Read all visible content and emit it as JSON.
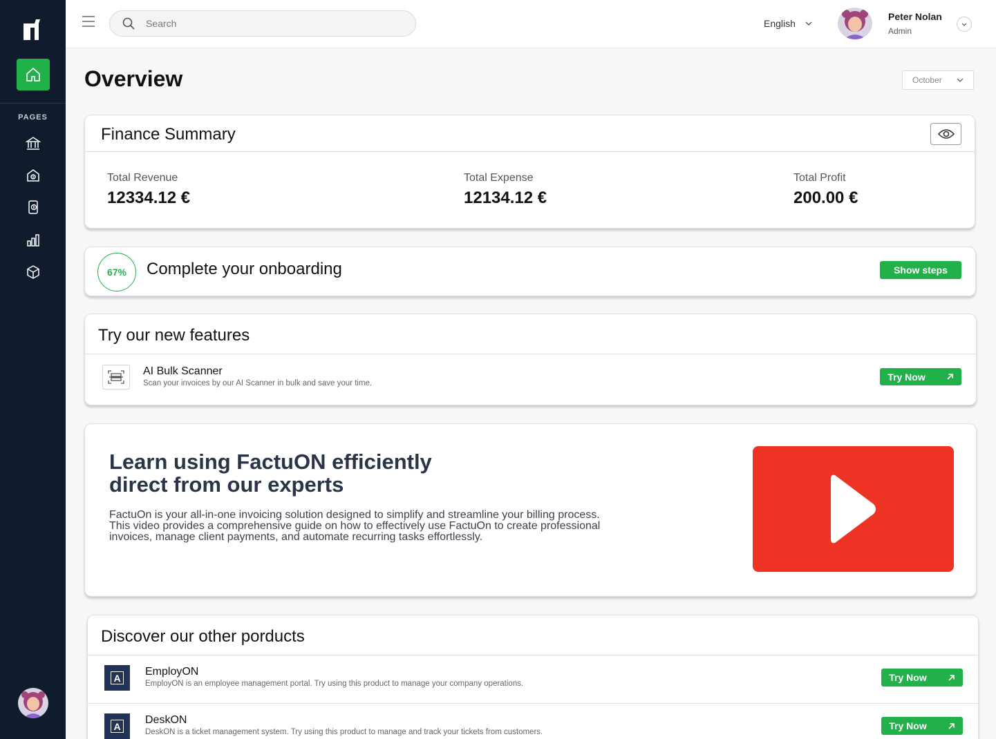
{
  "header": {
    "search_placeholder": "Search",
    "language": "English",
    "user_name": "Peter Nolan",
    "user_role": "Admin"
  },
  "sidebar": {
    "section_label": "PAGES",
    "icons": [
      "home-icon",
      "bank-icon",
      "safe-house-icon",
      "invoice-icon",
      "bar-chart-icon",
      "package-icon"
    ],
    "accent": "#22b04b",
    "bg": "#111b2e"
  },
  "overview": {
    "title": "Overview",
    "month": "October"
  },
  "finance": {
    "title": "Finance Summary",
    "revenue_label": "Total Revenue",
    "revenue_value": "12334.12 €",
    "expense_label": "Total Expense",
    "expense_value": "12134.12 €",
    "profit_label": "Total Profit",
    "profit_value": "200.00 €"
  },
  "onboarding": {
    "progress": "67%",
    "progress_fraction": 0.67,
    "title": "Complete your onboarding",
    "button": "Show steps"
  },
  "features": {
    "title": "Try our new features",
    "items": [
      {
        "title": "AI Bulk Scanner",
        "desc": "Scan your invoices by our AI Scanner in bulk and save your time.",
        "button": "Try Now"
      }
    ]
  },
  "learn": {
    "title_line1": "Learn using FactuON efficiently",
    "title_line2": "direct from our experts",
    "desc_line1": "FactuOn is your all-in-one invoicing solution designed to simplify and streamline your billing process.",
    "desc_line2": "This video provides a comprehensive guide on how to effectively use FactuOn to create professional",
    "desc_line3": "invoices, manage client payments, and automate recurring tasks effortlessly.",
    "video_color": "#ee3325"
  },
  "products": {
    "title": "Discover our other porducts",
    "items": [
      {
        "name": "EmployON",
        "desc": "EmployON is an employee management portal. Try using this product to manage your company operations.",
        "button": "Try Now"
      },
      {
        "name": "DeskON",
        "desc": "DeskON is a ticket management system. Try using this product to manage and track your tickets from customers.",
        "button": "Try Now"
      }
    ]
  }
}
